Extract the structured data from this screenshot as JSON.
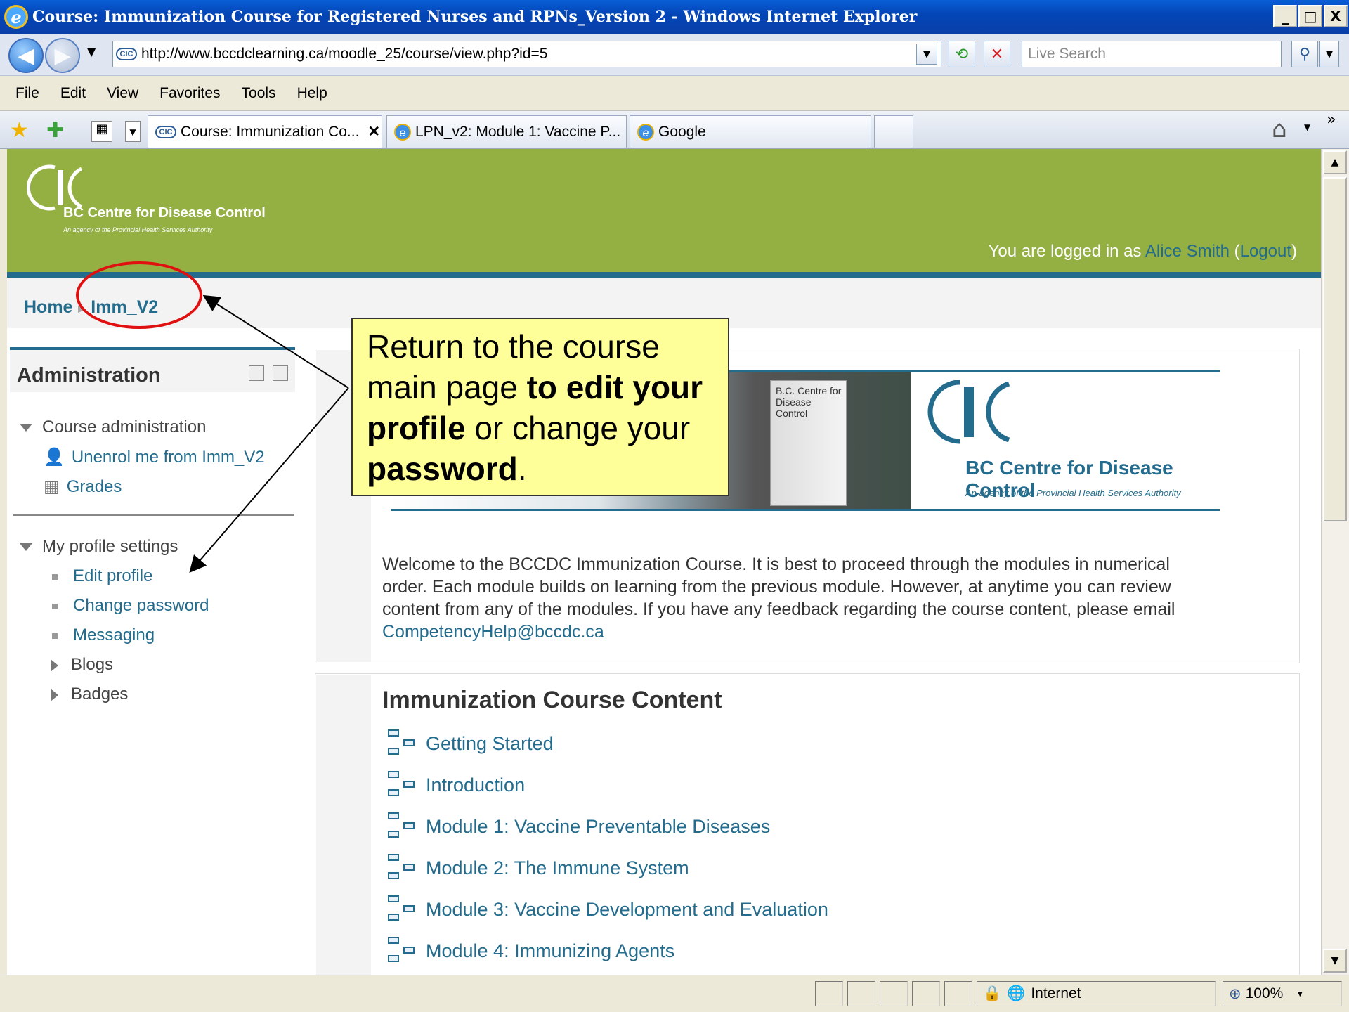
{
  "window": {
    "title": "Course: Immunization Course for Registered Nurses and RPNs_Version 2 - Windows Internet Explorer",
    "min": "_",
    "max": "□",
    "close": "X"
  },
  "address": {
    "url": "http://www.bccdclearning.ca/moodle_25/course/view.php?id=5",
    "search_placeholder": "Live Search"
  },
  "menu": [
    "File",
    "Edit",
    "View",
    "Favorites",
    "Tools",
    "Help"
  ],
  "tabs": [
    {
      "label": "Course: Immunization Co...",
      "close": "✕"
    },
    {
      "label": "LPN_v2: Module 1: Vaccine P..."
    },
    {
      "label": "Google"
    }
  ],
  "header": {
    "brand_name": "BC Centre for Disease Control",
    "brand_sub": "An agency of the Provincial Health Services Authority",
    "login_prefix": "You are logged in as ",
    "user": "Alice Smith",
    "logout": "Logout"
  },
  "breadcrumb": {
    "home": "Home",
    "sep": "►",
    "course": "Imm_V2"
  },
  "admin": {
    "title": "Administration",
    "course_admin": "Course administration",
    "unenrol": "Unenrol me from Imm_V2",
    "grades": "Grades",
    "profile_settings": "My profile settings",
    "edit_profile": "Edit profile",
    "change_password": "Change password",
    "messaging": "Messaging",
    "blogs": "Blogs",
    "badges": "Badges"
  },
  "banner": {
    "book_text": "B.C. Centre for Disease Control",
    "name": "BC Centre for Disease Control",
    "sub": "An agency of the Provincial Health Services Authority"
  },
  "welcome": {
    "text": "Welcome to the BCCDC Immunization Course. It is best to proceed through the modules in numerical order. Each module builds on learning from the previous module. However, at anytime you can review content from any of the modules. If you have any feedback regarding the course content, please email ",
    "email": "CompetencyHelp@bccdc.ca"
  },
  "course": {
    "title": "Immunization Course Content",
    "modules": [
      "Getting Started",
      "Introduction",
      "Module 1: Vaccine Preventable Diseases",
      "Module 2: The Immune System",
      "Module 3: Vaccine Development and Evaluation",
      "Module 4: Immunizing Agents"
    ]
  },
  "callout": {
    "t1": "Return to the course main page ",
    "b1": "to edit your profile",
    "t2": " or change your ",
    "b2": "password",
    "t3": "."
  },
  "status": {
    "zone": "Internet",
    "zoom": "100%"
  }
}
